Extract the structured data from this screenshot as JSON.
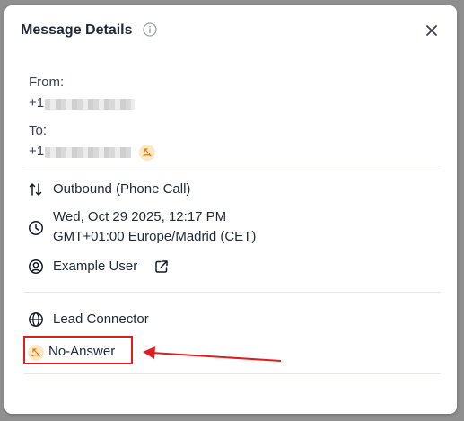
{
  "modal": {
    "title": "Message Details",
    "from_label": "From:",
    "from_prefix": "+1",
    "to_label": "To:",
    "to_prefix": "+1",
    "direction": "Outbound (Phone Call)",
    "datetime_line1": "Wed, Oct 29 2025, 12:17 PM",
    "datetime_line2": "GMT+01:00 Europe/Madrid (CET)",
    "user": "Example User",
    "source": "Lead Connector",
    "status": "No-Answer"
  },
  "colors": {
    "annotation": "#e01e1e",
    "status_badge_bg": "#fde7c4",
    "status_icon": "#d97706"
  },
  "icons": {
    "info": "info-icon",
    "close": "close-icon",
    "direction": "arrows-up-down-icon",
    "time": "clock-icon",
    "user": "user-circle-icon",
    "external": "external-link-icon",
    "source": "globe-icon",
    "status": "missed-call-icon"
  }
}
